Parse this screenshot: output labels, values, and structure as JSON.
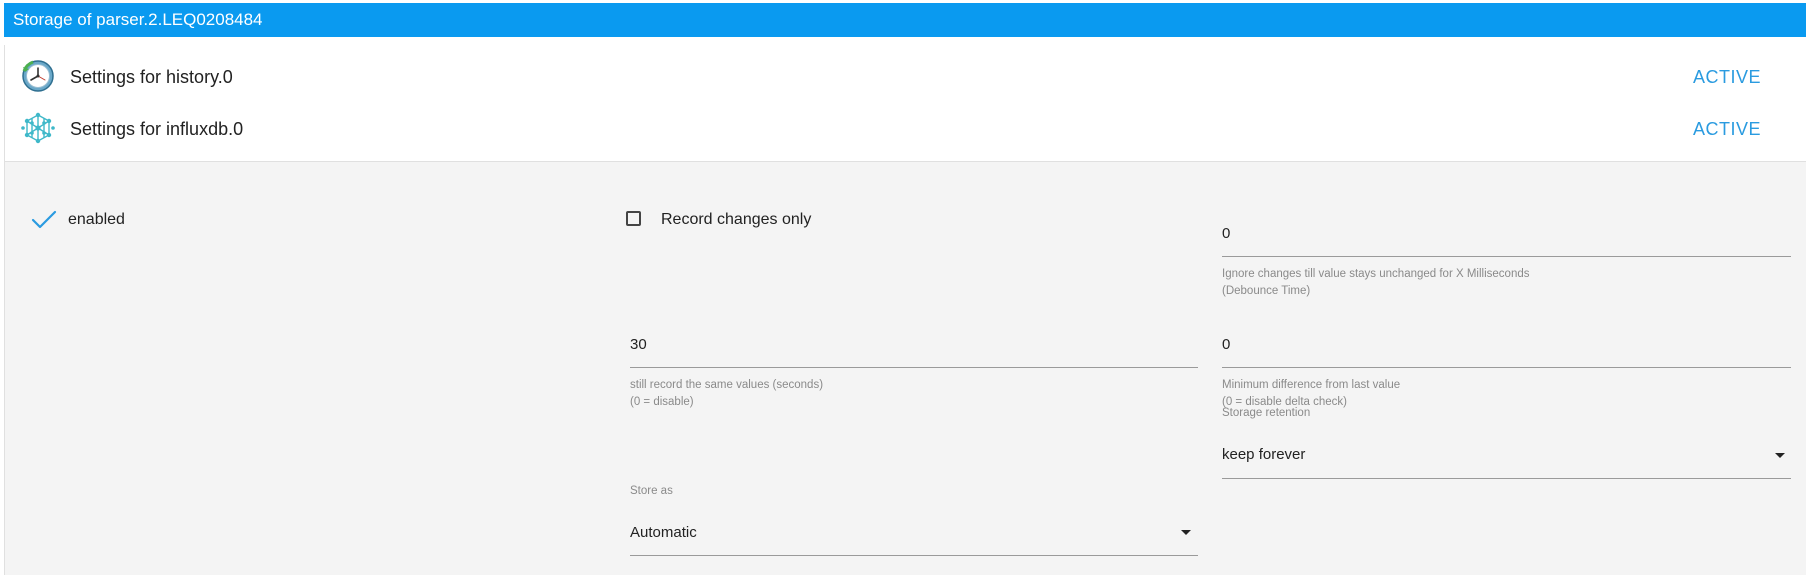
{
  "window": {
    "title": "Storage of parser.2.LEQ0208484"
  },
  "adapters": [
    {
      "title": "Settings for history.0",
      "status": "ACTIVE",
      "icon": "history-clock-icon"
    },
    {
      "title": "Settings for influxdb.0",
      "status": "ACTIVE",
      "icon": "influxdb-network-icon"
    }
  ],
  "settings": {
    "enabled_label": "enabled",
    "record_changes_only_label": "Record changes only",
    "debounce": {
      "value": "0",
      "helper_line1": "Ignore changes till value stays unchanged for X Milliseconds",
      "helper_line2": "(Debounce Time)"
    },
    "same_values": {
      "value": "30",
      "helper_line1": "still record the same values (seconds)",
      "helper_line2": "(0 = disable)"
    },
    "min_difference": {
      "value": "0",
      "helper_line1": "Minimum difference from last value",
      "helper_line2": "(0 = disable delta check)"
    },
    "storage_retention": {
      "label": "Storage retention",
      "value": "keep forever"
    },
    "store_as": {
      "label": "Store as",
      "value": "Automatic"
    }
  },
  "colors": {
    "title_bar": "#0a9af0",
    "status_active": "#2a9be0",
    "check": "#2a9be0"
  }
}
